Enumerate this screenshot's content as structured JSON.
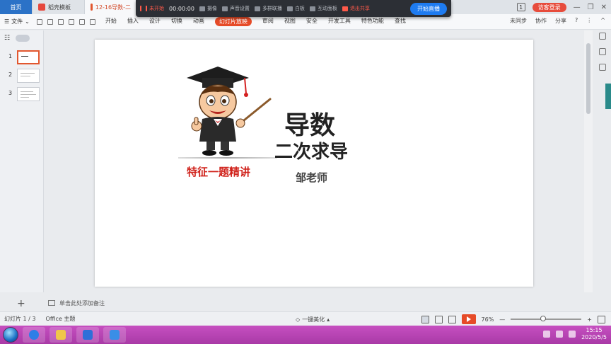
{
  "tabs": [
    {
      "label": "首页",
      "type": "home"
    },
    {
      "label": "稻壳模板",
      "type": "template"
    },
    {
      "label": "12-16导数-二",
      "type": "active"
    }
  ],
  "top_right": {
    "doc_count": "1",
    "guest_login": "访客登录",
    "minimize": "—",
    "restore": "❐",
    "close": "✕"
  },
  "live_bar": {
    "status": "未开始",
    "timer": "00:00:00",
    "camera": "摄像",
    "sound": "声音设置",
    "multi_join": "多群联播",
    "whiteboard": "白板",
    "interaction": "互动面板",
    "exit_share": "退出共享",
    "start_live": "开始直播"
  },
  "ribbon": {
    "file_label": "文件",
    "menus": [
      "开始",
      "插入",
      "设计",
      "切换",
      "动画",
      "幻灯片放映",
      "审阅",
      "视图",
      "安全",
      "开发工具",
      "特色功能",
      "查找"
    ],
    "active_menu": "幻灯片放映",
    "sync": "未同步",
    "collab": "协作",
    "share": "分享",
    "help": "?",
    "more": "⋮",
    "collapse": "^"
  },
  "slides": {
    "thumbnails": [
      "1",
      "2",
      "3"
    ],
    "selected": "1",
    "add_label": "+"
  },
  "slide": {
    "title_main": "导数",
    "title_sub": "二次求导",
    "teacher": "邹老师",
    "feature": "特征一题精讲"
  },
  "notes": {
    "placeholder": "单击此处添加备注"
  },
  "status": {
    "slide_position": "幻灯片 1 / 3",
    "theme": "Office 主题",
    "beautify": "一键美化",
    "zoom": "76%",
    "zoom_minus": "—",
    "zoom_plus": "+"
  },
  "taskbar": {
    "time": "15:15",
    "date": "2020/5/5"
  },
  "colors": {
    "accent": "#e64b28",
    "home_tab": "#2b72c7",
    "live_button": "#1e7bf0",
    "feature_text": "#d0221b",
    "taskbar": "#b844b5"
  }
}
